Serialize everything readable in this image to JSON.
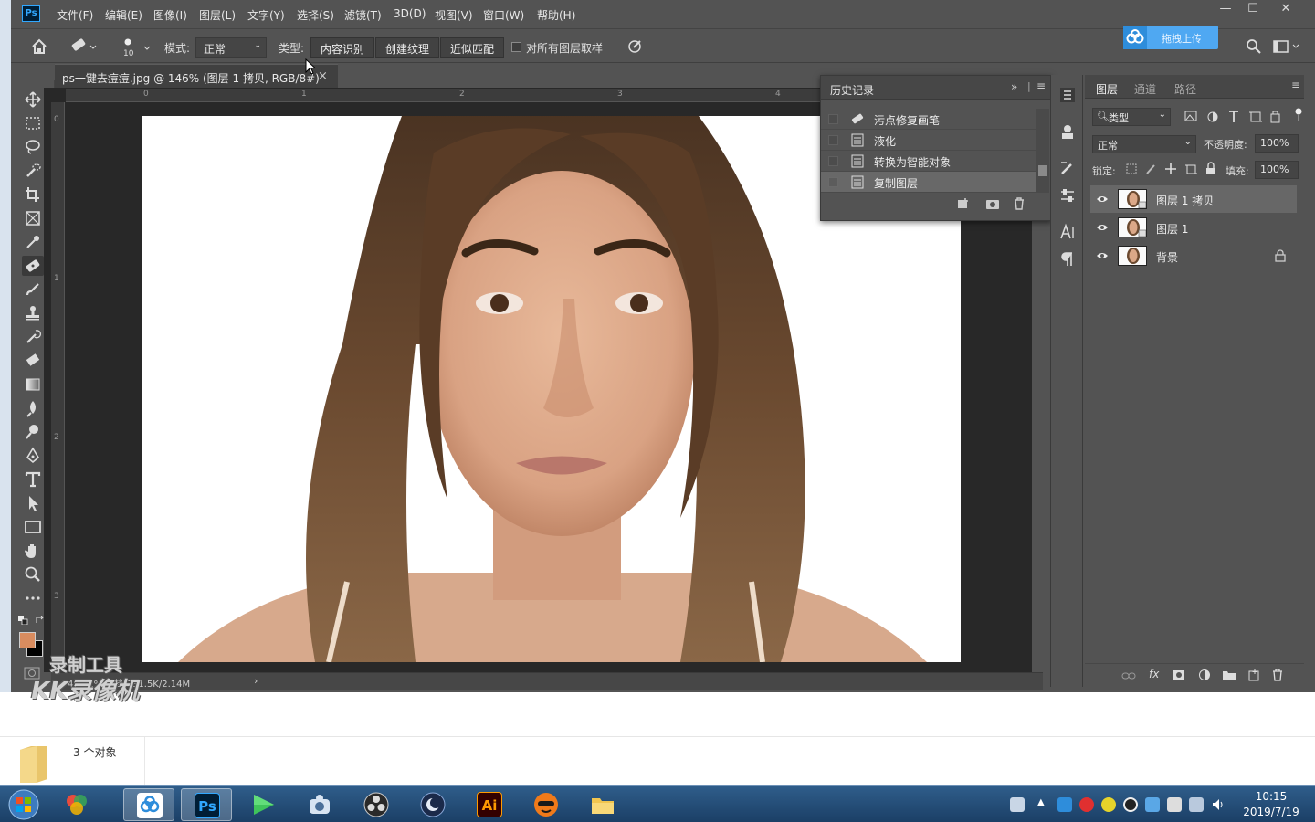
{
  "app": {
    "logo": "Ps",
    "menu": [
      "文件(F)",
      "编辑(E)",
      "图像(I)",
      "图层(L)",
      "文字(Y)",
      "选择(S)",
      "滤镜(T)",
      "3D(D)",
      "视图(V)",
      "窗口(W)",
      "帮助(H)"
    ],
    "window_buttons": [
      "—",
      "☐",
      "✕"
    ]
  },
  "options": {
    "brush_size": "10",
    "mode_label": "模式:",
    "mode_value": "正常",
    "type_label": "类型:",
    "type_buttons": [
      "内容识别",
      "创建纹理",
      "近似匹配"
    ],
    "sample_all_label": "对所有图层取样",
    "upload_label": "拖拽上传"
  },
  "document": {
    "tab_title": "ps一键去痘痘.jpg @ 146% (图层 1 拷贝, RGB/8#)",
    "close": "×",
    "ruler_h": [
      "0",
      "1",
      "2",
      "3",
      "4"
    ],
    "ruler_v": [
      "0",
      "1",
      "2",
      "3"
    ],
    "status": "46.61%    文档:731.5K/2.14M",
    "status_arrow": "›"
  },
  "history": {
    "tab": "历史记录",
    "items": [
      {
        "label": "污点修复画笔",
        "icon": "healing-brush-icon"
      },
      {
        "label": "液化",
        "icon": "document-icon"
      },
      {
        "label": "转换为智能对象",
        "icon": "document-icon"
      },
      {
        "label": "复制图层",
        "icon": "document-icon"
      }
    ],
    "selected_index": 3
  },
  "layers": {
    "tabs": [
      "图层",
      "通道",
      "路径"
    ],
    "filter_label": "类型",
    "blend_mode": "正常",
    "opacity_label": "不透明度:",
    "opacity_value": "100%",
    "lock_label": "锁定:",
    "fill_label": "填充:",
    "fill_value": "100%",
    "items": [
      {
        "name": "图层 1 拷贝",
        "selected": true,
        "locked": false
      },
      {
        "name": "图层 1",
        "selected": false,
        "locked": false
      },
      {
        "name": "背景",
        "selected": false,
        "locked": true
      }
    ],
    "footer_fx": "fx"
  },
  "explorer": {
    "object_count": "3 个对象"
  },
  "taskbar": {
    "apps": [
      "start",
      "baidu-netdisk",
      "photoshop",
      "media-player",
      "screen-recorder",
      "obs",
      "cinema4d",
      "illustrator",
      "game-app",
      "file-explorer"
    ],
    "ps_label": "Ps",
    "ai_label": "Ai",
    "time": "10:15",
    "date": "2019/7/19"
  },
  "watermark": {
    "line1": "录制工具",
    "line2": "KK录像机"
  },
  "colors": {
    "foreground": "#d98c5f",
    "background": "#000000",
    "accent_blue": "#31a8ff"
  }
}
